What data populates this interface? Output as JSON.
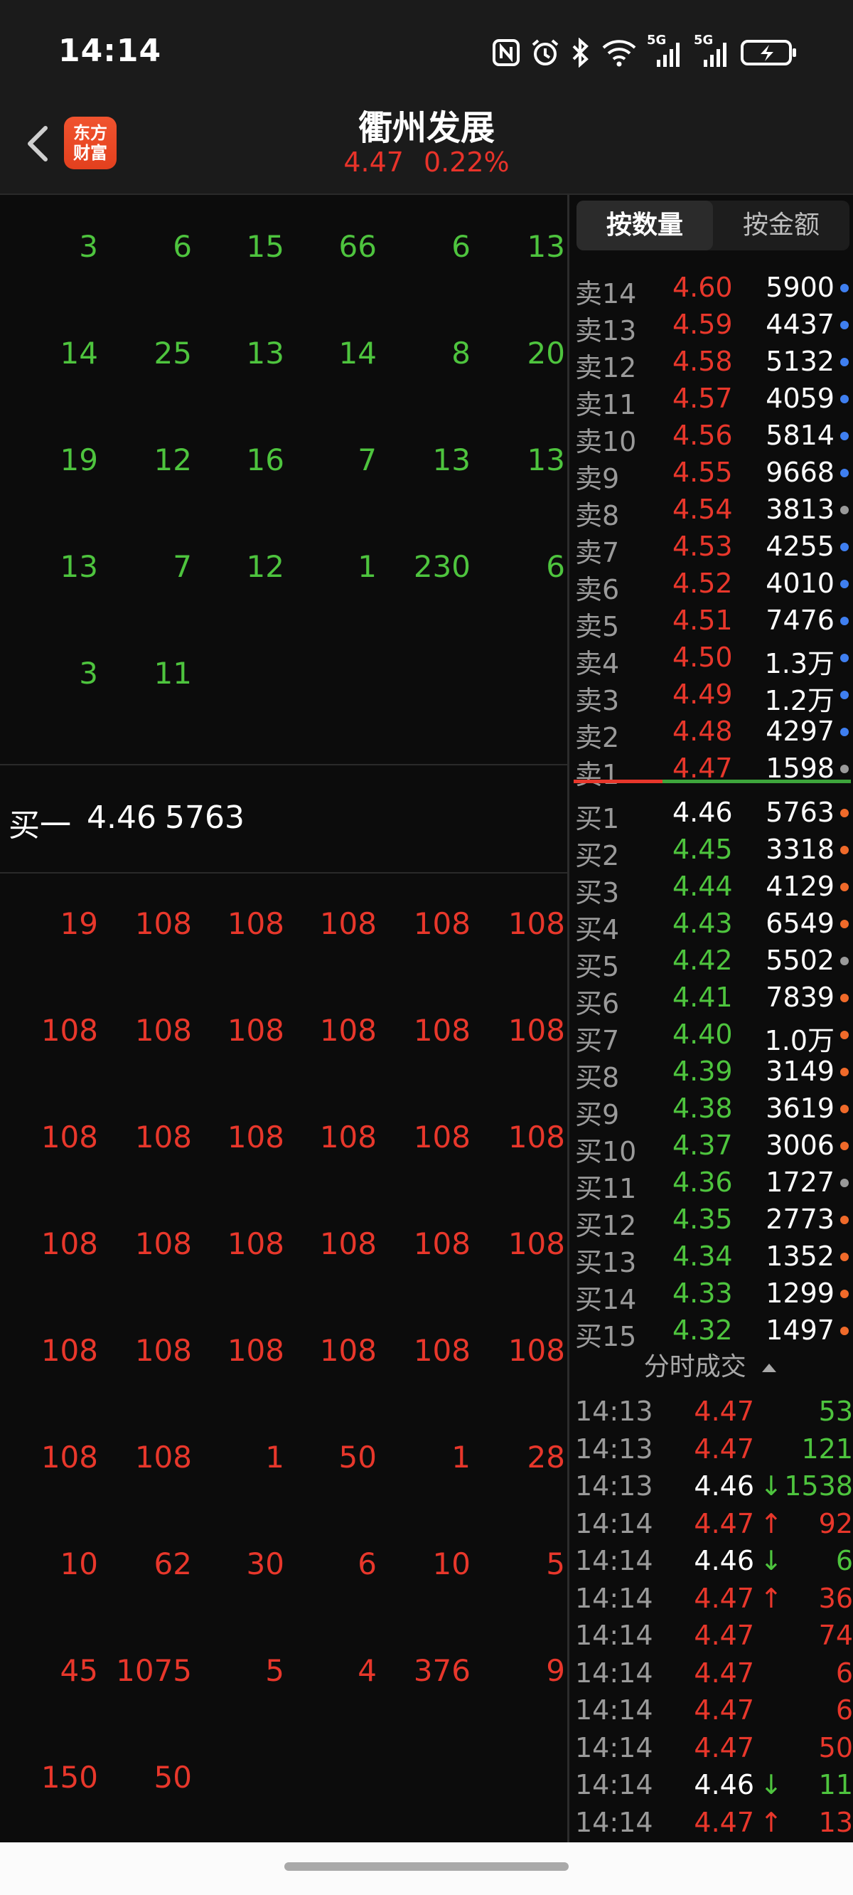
{
  "status_bar": {
    "time": "14:14",
    "icons": [
      "nfc-icon",
      "alarm-icon",
      "bluetooth-icon",
      "wifi-icon",
      "signal-5g-icon",
      "signal-5g-icon",
      "battery-charging-icon"
    ],
    "signal_labels": [
      "5G",
      "5G"
    ]
  },
  "header": {
    "back_icon": "chevron-left-icon",
    "logo_text": [
      "东方",
      "财富"
    ],
    "stock_name": "衢州发展",
    "price": "4.47",
    "change_pct": "0.22%"
  },
  "queue": {
    "sell_rows": [
      [
        "3",
        "6",
        "15",
        "66",
        "6",
        "13"
      ],
      [
        "14",
        "25",
        "13",
        "14",
        "8",
        "20"
      ],
      [
        "19",
        "12",
        "16",
        "7",
        "13",
        "13"
      ],
      [
        "13",
        "7",
        "12",
        "1",
        "230",
        "6"
      ],
      [
        "3",
        "11"
      ]
    ],
    "buy1": {
      "label": "买一",
      "price": "4.46",
      "volume": "5763"
    },
    "buy_rows": [
      [
        "19",
        "108",
        "108",
        "108",
        "108",
        "108"
      ],
      [
        "108",
        "108",
        "108",
        "108",
        "108",
        "108"
      ],
      [
        "108",
        "108",
        "108",
        "108",
        "108",
        "108"
      ],
      [
        "108",
        "108",
        "108",
        "108",
        "108",
        "108"
      ],
      [
        "108",
        "108",
        "108",
        "108",
        "108",
        "108"
      ],
      [
        "108",
        "108",
        "1",
        "50",
        "1",
        "28"
      ],
      [
        "10",
        "62",
        "30",
        "6",
        "10",
        "5"
      ],
      [
        "45",
        "1075",
        "5",
        "4",
        "376",
        "9"
      ],
      [
        "150",
        "50"
      ]
    ]
  },
  "tabs": {
    "by_volume": "按数量",
    "by_amount": "按金额"
  },
  "order_book": {
    "asks": [
      {
        "label": "卖14",
        "price": "4.60",
        "vol": "5900",
        "dot": "#3f7ff0"
      },
      {
        "label": "卖13",
        "price": "4.59",
        "vol": "4437",
        "dot": "#3f7ff0"
      },
      {
        "label": "卖12",
        "price": "4.58",
        "vol": "5132",
        "dot": "#3f7ff0"
      },
      {
        "label": "卖11",
        "price": "4.57",
        "vol": "4059",
        "dot": "#3f7ff0"
      },
      {
        "label": "卖10",
        "price": "4.56",
        "vol": "5814",
        "dot": "#3f7ff0"
      },
      {
        "label": "卖9",
        "price": "4.55",
        "vol": "9668",
        "dot": "#3f7ff0"
      },
      {
        "label": "卖8",
        "price": "4.54",
        "vol": "3813",
        "dot": "#9a9a9a"
      },
      {
        "label": "卖7",
        "price": "4.53",
        "vol": "4255",
        "dot": "#3f7ff0"
      },
      {
        "label": "卖6",
        "price": "4.52",
        "vol": "4010",
        "dot": "#3f7ff0"
      },
      {
        "label": "卖5",
        "price": "4.51",
        "vol": "7476",
        "dot": "#3f7ff0"
      },
      {
        "label": "卖4",
        "price": "4.50",
        "vol": "1.3万",
        "dot": "#3f7ff0"
      },
      {
        "label": "卖3",
        "price": "4.49",
        "vol": "1.2万",
        "dot": "#3f7ff0"
      },
      {
        "label": "卖2",
        "price": "4.48",
        "vol": "4297",
        "dot": "#3f7ff0"
      },
      {
        "label": "卖1",
        "price": "4.47",
        "vol": "1598",
        "dot": "#9a9a9a"
      }
    ],
    "bids": [
      {
        "label": "买1",
        "price": "4.46",
        "vol": "5763",
        "dot": "#f06a2a",
        "price_color": "#ffffff"
      },
      {
        "label": "买2",
        "price": "4.45",
        "vol": "3318",
        "dot": "#f06a2a",
        "price_color": "#4ec43e"
      },
      {
        "label": "买3",
        "price": "4.44",
        "vol": "4129",
        "dot": "#f06a2a",
        "price_color": "#4ec43e"
      },
      {
        "label": "买4",
        "price": "4.43",
        "vol": "6549",
        "dot": "#f06a2a",
        "price_color": "#4ec43e"
      },
      {
        "label": "买5",
        "price": "4.42",
        "vol": "5502",
        "dot": "#9a9a9a",
        "price_color": "#4ec43e"
      },
      {
        "label": "买6",
        "price": "4.41",
        "vol": "7839",
        "dot": "#f06a2a",
        "price_color": "#4ec43e"
      },
      {
        "label": "买7",
        "price": "4.40",
        "vol": "1.0万",
        "dot": "#f06a2a",
        "price_color": "#4ec43e"
      },
      {
        "label": "买8",
        "price": "4.39",
        "vol": "3149",
        "dot": "#f06a2a",
        "price_color": "#4ec43e"
      },
      {
        "label": "买9",
        "price": "4.38",
        "vol": "3619",
        "dot": "#f06a2a",
        "price_color": "#4ec43e"
      },
      {
        "label": "买10",
        "price": "4.37",
        "vol": "3006",
        "dot": "#f06a2a",
        "price_color": "#4ec43e"
      },
      {
        "label": "买11",
        "price": "4.36",
        "vol": "1727",
        "dot": "#9a9a9a",
        "price_color": "#4ec43e"
      },
      {
        "label": "买12",
        "price": "4.35",
        "vol": "2773",
        "dot": "#f06a2a",
        "price_color": "#4ec43e"
      },
      {
        "label": "买13",
        "price": "4.34",
        "vol": "1352",
        "dot": "#f06a2a",
        "price_color": "#4ec43e"
      },
      {
        "label": "买14",
        "price": "4.33",
        "vol": "1299",
        "dot": "#f06a2a",
        "price_color": "#4ec43e"
      },
      {
        "label": "买15",
        "price": "4.32",
        "vol": "1497",
        "dot": "#f06a2a",
        "price_color": "#4ec43e"
      }
    ]
  },
  "ticks": {
    "title": "分时成交",
    "rows": [
      {
        "time": "14:13",
        "price": "4.47",
        "arrow": "",
        "vol": "53",
        "price_color": "#e8372b",
        "vol_color": "#4ec43e"
      },
      {
        "time": "14:13",
        "price": "4.47",
        "arrow": "",
        "vol": "121",
        "price_color": "#e8372b",
        "vol_color": "#4ec43e"
      },
      {
        "time": "14:13",
        "price": "4.46",
        "arrow": "↓",
        "vol": "1538",
        "price_color": "#ffffff",
        "vol_color": "#4ec43e"
      },
      {
        "time": "14:14",
        "price": "4.47",
        "arrow": "↑",
        "vol": "92",
        "price_color": "#e8372b",
        "vol_color": "#e8372b"
      },
      {
        "time": "14:14",
        "price": "4.46",
        "arrow": "↓",
        "vol": "6",
        "price_color": "#ffffff",
        "vol_color": "#4ec43e"
      },
      {
        "time": "14:14",
        "price": "4.47",
        "arrow": "↑",
        "vol": "36",
        "price_color": "#e8372b",
        "vol_color": "#e8372b"
      },
      {
        "time": "14:14",
        "price": "4.47",
        "arrow": "",
        "vol": "74",
        "price_color": "#e8372b",
        "vol_color": "#e8372b"
      },
      {
        "time": "14:14",
        "price": "4.47",
        "arrow": "",
        "vol": "6",
        "price_color": "#e8372b",
        "vol_color": "#e8372b"
      },
      {
        "time": "14:14",
        "price": "4.47",
        "arrow": "",
        "vol": "6",
        "price_color": "#e8372b",
        "vol_color": "#e8372b"
      },
      {
        "time": "14:14",
        "price": "4.47",
        "arrow": "",
        "vol": "50",
        "price_color": "#e8372b",
        "vol_color": "#e8372b"
      },
      {
        "time": "14:14",
        "price": "4.46",
        "arrow": "↓",
        "vol": "11",
        "price_color": "#ffffff",
        "vol_color": "#4ec43e"
      },
      {
        "time": "14:14",
        "price": "4.47",
        "arrow": "↑",
        "vol": "13",
        "price_color": "#e8372b",
        "vol_color": "#e8372b"
      }
    ]
  },
  "colors": {
    "up": "#e8372b",
    "down": "#4ec43e",
    "bg": "#0c0c0c",
    "logo": "#e94a25"
  }
}
